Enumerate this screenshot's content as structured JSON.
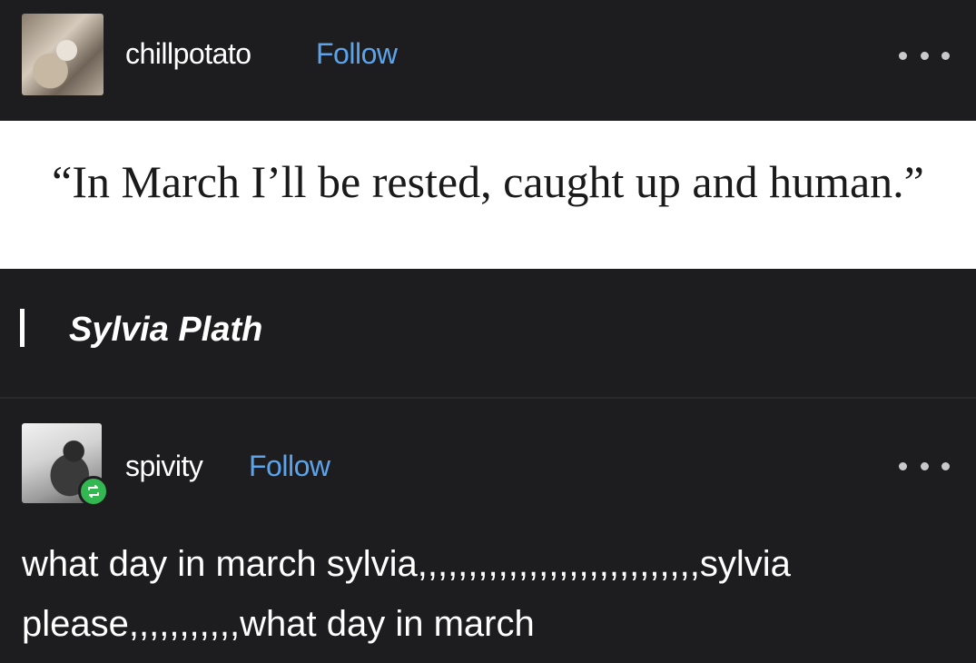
{
  "post": {
    "author": "chillpotato",
    "follow_label": "Follow",
    "quote": "“In March I’ll be rested, caught up and human.”",
    "attribution": "Sylvia Plath"
  },
  "reblog": {
    "author": "spivity",
    "follow_label": "Follow",
    "text": "what day in march sylvia,,,,,,,,,,,,,,,,,,,,,,,,,,,,sylvia please,,,,,,,,,,,what day in march"
  },
  "colors": {
    "background": "#1d1d1f",
    "follow_link": "#5ba3ea",
    "reblog_badge": "#33b851"
  },
  "icons": [
    "more-options-icon",
    "reblog-icon"
  ]
}
